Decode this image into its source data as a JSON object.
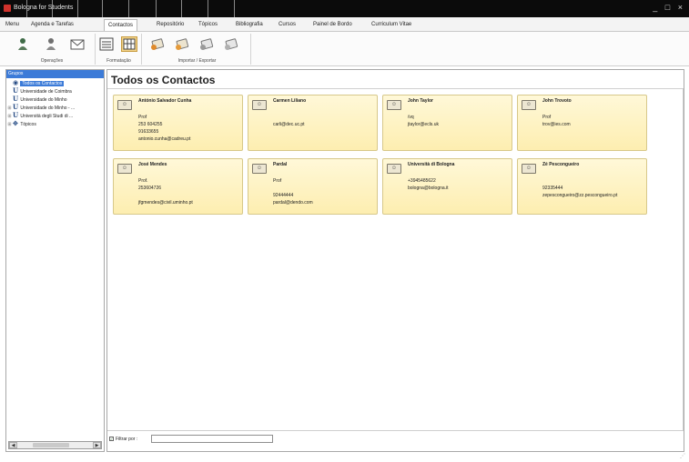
{
  "window": {
    "title": "Bologna for Students",
    "controls": "_ □ ×"
  },
  "tabs": [
    {
      "label": "Menu"
    },
    {
      "label": "Agenda e Tarefas"
    },
    {
      "label": "Contactos"
    },
    {
      "label": "Repositório"
    },
    {
      "label": "Tópicos"
    },
    {
      "label": "Bibliografia"
    },
    {
      "label": "Cursos"
    },
    {
      "label": "Painel de Bordo"
    },
    {
      "label": "Curriculum Vitae"
    }
  ],
  "ribbon": {
    "groups": [
      {
        "label": "Operações",
        "icons": [
          "add-contact-icon",
          "remove-contact-icon",
          "email-icon"
        ]
      },
      {
        "label": "Formatação",
        "icons": [
          "list-view-icon",
          "card-view-icon"
        ]
      },
      {
        "label": "Importar / Exportar",
        "icons": [
          "import-icon-1",
          "import-icon-2",
          "export-icon-1",
          "export-icon-2"
        ]
      }
    ]
  },
  "sidebar": {
    "header": "Grupos",
    "items": [
      {
        "label": "Todos os Contactos",
        "selected": true,
        "icon": "contacts-icon"
      },
      {
        "label": "Universidade de Coimbra",
        "icon": "university-icon"
      },
      {
        "label": "Universidade do Minho",
        "icon": "university-icon"
      },
      {
        "label": "Universidade do Minho - ...",
        "icon": "university-icon"
      },
      {
        "label": "Università degli Studi di ...",
        "icon": "university-icon"
      },
      {
        "label": "Tópicos",
        "icon": "topics-icon"
      }
    ]
  },
  "main": {
    "title": "Todos os Contactos",
    "filter": {
      "label": "Filtrar por :",
      "value": "",
      "checked": true
    },
    "cards": [
      {
        "name": "António Salvador Cunha",
        "lines": [
          "Prof",
          "253 604255",
          "91633655",
          "antonio.cunha@cadreu.pt"
        ]
      },
      {
        "name": "Carmen Liliano",
        "lines": [
          "",
          "carli@dec.uc.pt"
        ]
      },
      {
        "name": "John Taylor",
        "lines": [
          "/vq",
          "jtaylor@ecls.uk"
        ]
      },
      {
        "name": "John Trovoto",
        "lines": [
          "Prof",
          "trov@ies.com"
        ]
      },
      {
        "name": "José Mendes",
        "lines": [
          "Prof.",
          "253604726",
          "",
          "jfgmendes@civil.uminho.pt"
        ]
      },
      {
        "name": "Pardal",
        "lines": [
          "Prof",
          "",
          "92444444",
          "pardal@dendo.com"
        ]
      },
      {
        "name": "Università di Bologna",
        "lines": [
          "+3945485622",
          "bologna@bologna.it"
        ]
      },
      {
        "name": "Zé Pescongueiro",
        "lines": [
          "",
          "92335444",
          "zepescongueiro@zz.pescongueiro.pt"
        ]
      }
    ]
  }
}
